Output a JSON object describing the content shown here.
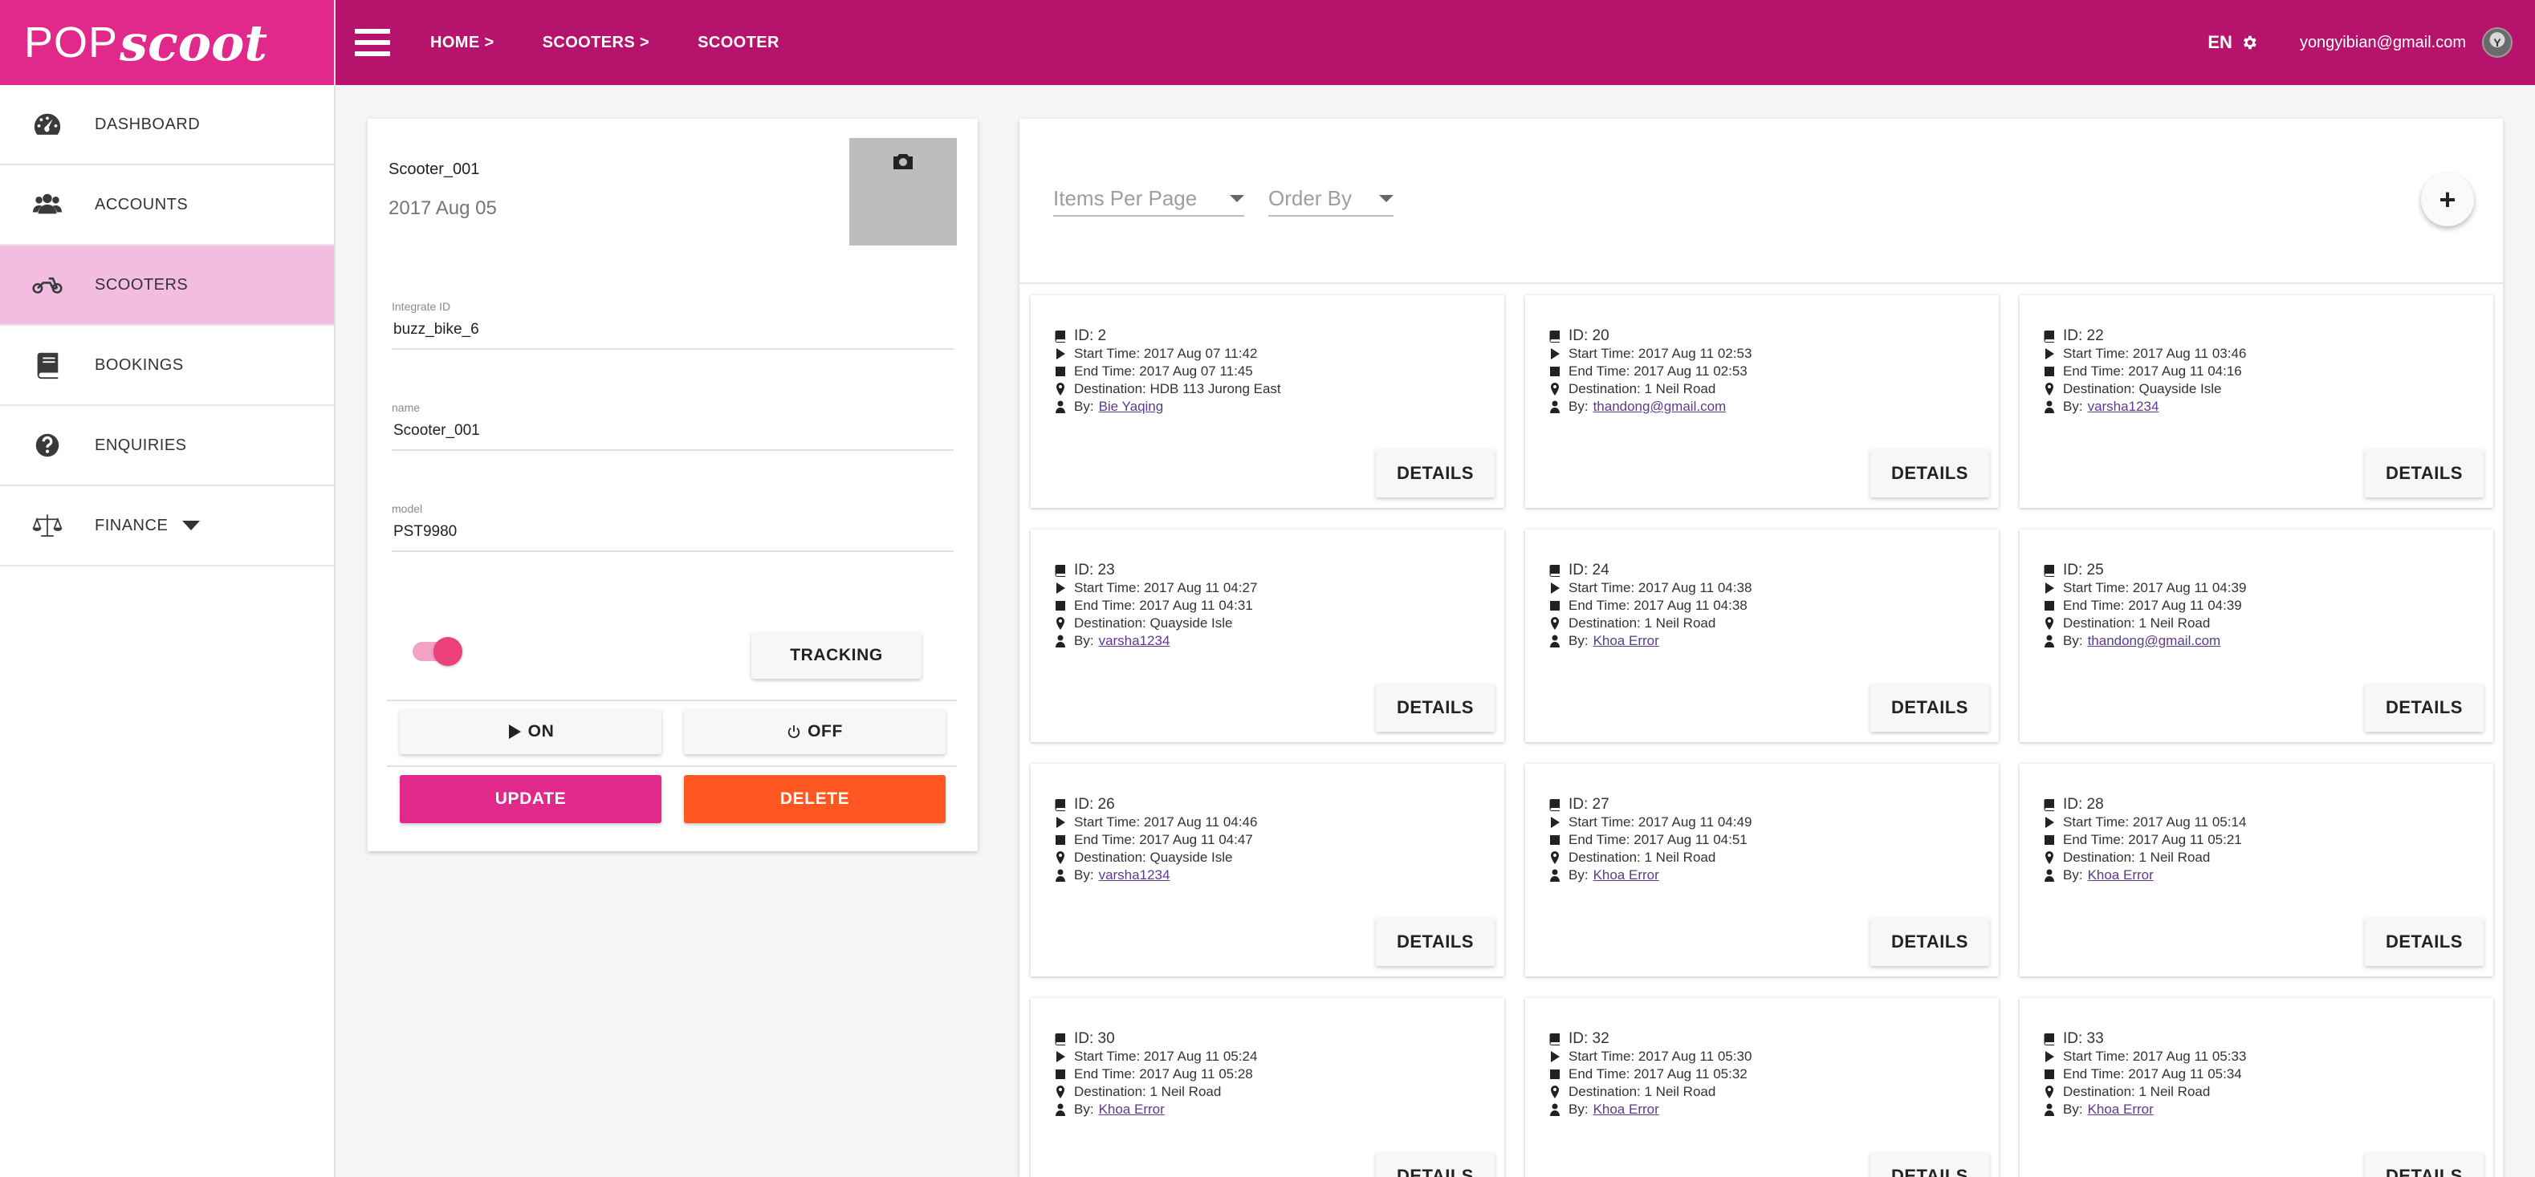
{
  "brand": {
    "part1": "POP",
    "part2": "scoot"
  },
  "sidebar": {
    "items": [
      {
        "label": "DASHBOARD",
        "icon": "dashboard-icon"
      },
      {
        "label": "ACCOUNTS",
        "icon": "users-icon"
      },
      {
        "label": "SCOOTERS",
        "icon": "motorcycle-icon"
      },
      {
        "label": "BOOKINGS",
        "icon": "book-icon"
      },
      {
        "label": "ENQUIRIES",
        "icon": "question-icon"
      },
      {
        "label": "FINANCE",
        "icon": "balance-scale-icon"
      }
    ]
  },
  "topbar": {
    "breadcrumbs": [
      "HOME >",
      "SCOOTERS >",
      "SCOOTER"
    ],
    "lang": "EN",
    "email": "yongyibian@gmail.com",
    "avatar": "Y"
  },
  "scooter": {
    "name": "Scooter_001",
    "date": "2017 Aug 05",
    "fields": {
      "integrate_id": {
        "label": "Integrate ID",
        "value": "buzz_bike_6"
      },
      "name": {
        "label": "name",
        "value": "Scooter_001"
      },
      "model": {
        "label": "model",
        "value": "PST9980"
      }
    },
    "toggle_on": true,
    "buttons": {
      "tracking": "TRACKING",
      "on": "ON",
      "off": "OFF",
      "update": "UPDATE",
      "delete": "DELETE"
    }
  },
  "filters": {
    "items_per_page": "Items Per Page",
    "order_by": "Order By",
    "add": "+"
  },
  "bookings": {
    "details_label": "DETAILS",
    "items": [
      {
        "id": "ID: 2",
        "start": "Start Time: 2017 Aug 07 11:42",
        "end": "End Time: 2017 Aug 07 11:45",
        "dest": "Destination: HDB 113 Jurong East",
        "by_prefix": "By:",
        "by": "Bie Yaqing"
      },
      {
        "id": "ID: 20",
        "start": "Start Time: 2017 Aug 11 02:53",
        "end": "End Time: 2017 Aug 11 02:53",
        "dest": "Destination: 1 Neil Road",
        "by_prefix": "By:",
        "by": "thandong@gmail.com"
      },
      {
        "id": "ID: 22",
        "start": "Start Time: 2017 Aug 11 03:46",
        "end": "End Time: 2017 Aug 11 04:16",
        "dest": "Destination: Quayside Isle",
        "by_prefix": "By:",
        "by": "varsha1234"
      },
      {
        "id": "ID: 23",
        "start": "Start Time: 2017 Aug 11 04:27",
        "end": "End Time: 2017 Aug 11 04:31",
        "dest": "Destination: Quayside Isle",
        "by_prefix": "By:",
        "by": "varsha1234"
      },
      {
        "id": "ID: 24",
        "start": "Start Time: 2017 Aug 11 04:38",
        "end": "End Time: 2017 Aug 11 04:38",
        "dest": "Destination: 1 Neil Road",
        "by_prefix": "By:",
        "by": "Khoa Error"
      },
      {
        "id": "ID: 25",
        "start": "Start Time: 2017 Aug 11 04:39",
        "end": "End Time: 2017 Aug 11 04:39",
        "dest": "Destination: 1 Neil Road",
        "by_prefix": "By:",
        "by": "thandong@gmail.com"
      },
      {
        "id": "ID: 26",
        "start": "Start Time: 2017 Aug 11 04:46",
        "end": "End Time: 2017 Aug 11 04:47",
        "dest": "Destination: Quayside Isle",
        "by_prefix": "By:",
        "by": "varsha1234"
      },
      {
        "id": "ID: 27",
        "start": "Start Time: 2017 Aug 11 04:49",
        "end": "End Time: 2017 Aug 11 04:51",
        "dest": "Destination: 1 Neil Road",
        "by_prefix": "By:",
        "by": "Khoa Error"
      },
      {
        "id": "ID: 28",
        "start": "Start Time: 2017 Aug 11 05:14",
        "end": "End Time: 2017 Aug 11 05:21",
        "dest": "Destination: 1 Neil Road",
        "by_prefix": "By:",
        "by": "Khoa Error"
      },
      {
        "id": "ID: 30",
        "start": "Start Time: 2017 Aug 11 05:24",
        "end": "End Time: 2017 Aug 11 05:28",
        "dest": "Destination: 1 Neil Road",
        "by_prefix": "By:",
        "by": "Khoa Error"
      },
      {
        "id": "ID: 32",
        "start": "Start Time: 2017 Aug 11 05:30",
        "end": "End Time: 2017 Aug 11 05:32",
        "dest": "Destination: 1 Neil Road",
        "by_prefix": "By:",
        "by": "Khoa Error"
      },
      {
        "id": "ID: 33",
        "start": "Start Time: 2017 Aug 11 05:33",
        "end": "End Time: 2017 Aug 11 05:34",
        "dest": "Destination: 1 Neil Road",
        "by_prefix": "By:",
        "by": "Khoa Error"
      }
    ]
  },
  "colors": {
    "brand_pink": "#e1288b",
    "topbar": "#b5136c",
    "active_nav": "#f2bde0",
    "delete": "#ff5722"
  }
}
